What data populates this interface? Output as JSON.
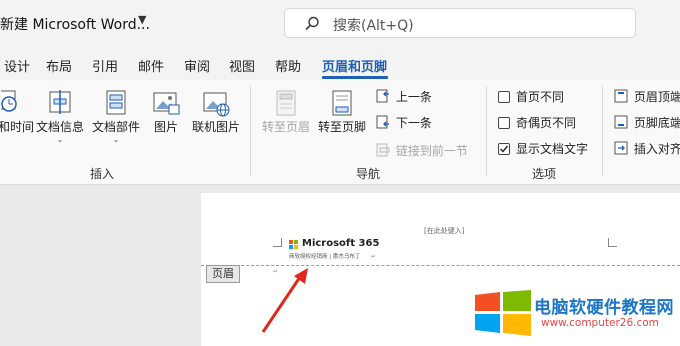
{
  "titlebar": {
    "doc_title": "新建 Microsoft Word...",
    "search_placeholder": "搜索(Alt+Q)"
  },
  "tabs": [
    "设计",
    "布局",
    "引用",
    "邮件",
    "审阅",
    "视图",
    "帮助",
    "页眉和页脚"
  ],
  "ribbon": {
    "insert_group": {
      "label": "插入",
      "buttons": [
        "和时间",
        "文档信息",
        "文档部件",
        "图片",
        "联机图片"
      ]
    },
    "nav_group": {
      "label": "导航",
      "goto_header": "转至页眉",
      "goto_footer": "转至页脚",
      "prev": "上一条",
      "next": "下一条",
      "link_prev": "链接到前一节"
    },
    "options_group": {
      "label": "选项",
      "diff_first": "首页不同",
      "diff_odd_even": "奇偶页不同",
      "show_doc_text": "显示文档文字"
    },
    "position_group": {
      "header_top": "页眉顶端",
      "footer_bottom": "页脚底端",
      "insert_align": "插入对齐"
    }
  },
  "document": {
    "placeholder": "[在此处键入]",
    "header_tag": "页眉",
    "brand": "Microsoft 365",
    "subtitle": "商软授权经销商 | 惠杰乌布丁",
    "para_mark": "↵"
  },
  "watermark": {
    "title": "电脑软硬件教程网",
    "url": "www.computer26.com"
  },
  "colors": {
    "accent": "#1e5fb8",
    "arrow": "#e0281c",
    "wm_blue": "#1d75c7",
    "wm_red": "#e64545"
  }
}
